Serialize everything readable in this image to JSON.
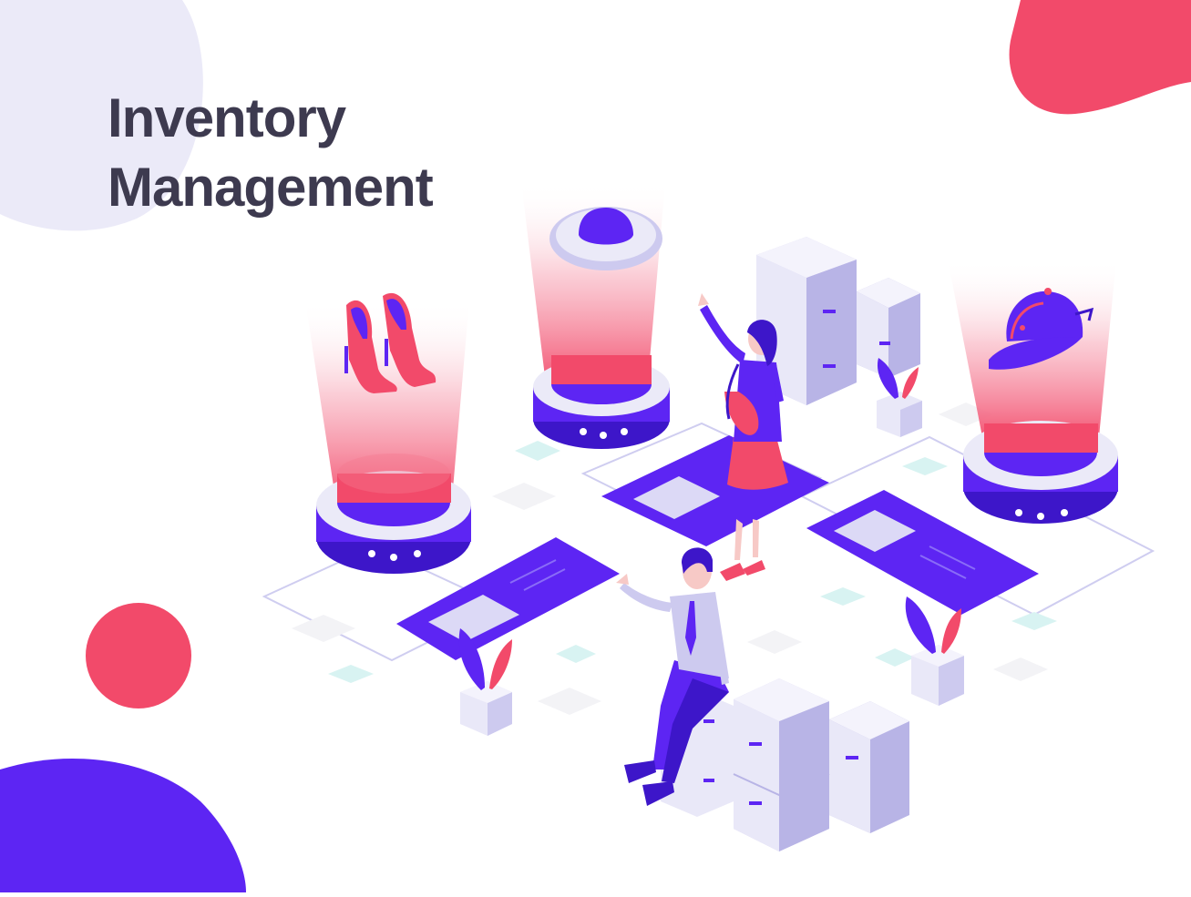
{
  "title": {
    "line1": "Inventory",
    "line2": "Management"
  },
  "colors": {
    "primary": "#5d25f3",
    "primary_dark": "#3d16c9",
    "accent_red": "#f24a6a",
    "light_lavender": "#ebeaf8",
    "box_face_light": "#e9e8f8",
    "box_face_mid": "#cdcaef",
    "box_face_dark": "#b8b4e6",
    "floor_tile_mint": "#d8f3f2",
    "floor_tile_grey": "#f3f3f6",
    "text_dark": "#3d3a4f"
  },
  "illustration": {
    "items_on_display": [
      "high-heel-shoes",
      "hat",
      "baseball-cap"
    ],
    "people": [
      "woman-pointing",
      "man-sitting"
    ]
  }
}
